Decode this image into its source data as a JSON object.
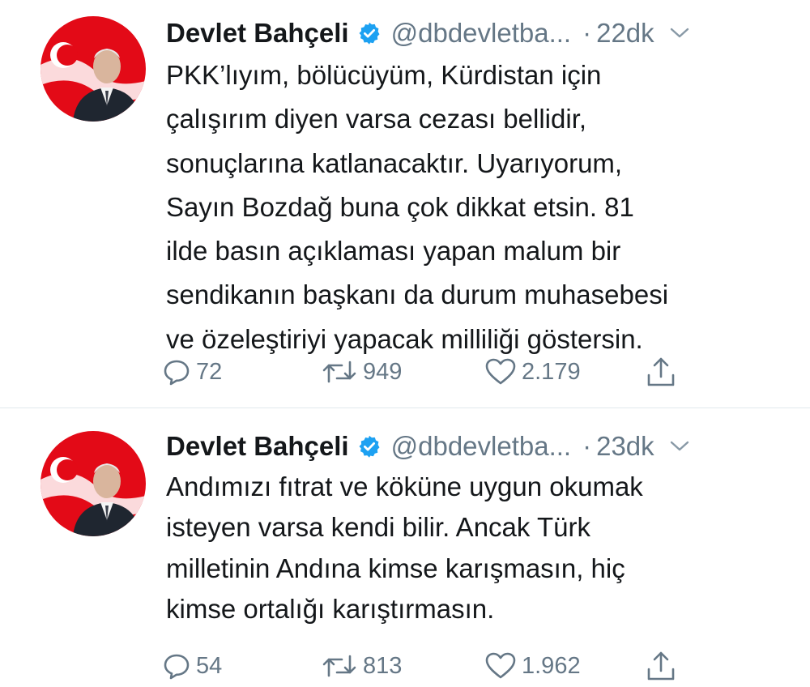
{
  "tweets": [
    {
      "name": "Devlet Bahçeli",
      "handle": "@dbdevletba...",
      "separator": "·",
      "time": "22dk",
      "text": "PKK’lıyım, bölücüyüm, Kürdistan için\nçalışırım diyen varsa cezası bellidir,\nsonuçlarına katlanacaktır. Uyarıyorum,\nSayın Bozdağ buna çok dikkat etsin. 81\nilde basın açıklaması yapan malum bir\nsendikanın başkanı da durum muhasebesi\nve özeleştiriyi yapacak milliliği göstersin.",
      "replies": "72",
      "retweets": "949",
      "likes": "2.179"
    },
    {
      "name": "Devlet Bahçeli",
      "handle": "@dbdevletba...",
      "separator": "·",
      "time": "23dk",
      "text": "Andımızı fıtrat ve köküne uygun okumak\nisteyen varsa kendi bilir. Ancak Türk\nmilletinin Andına kimse karışmasın, hiç\nkimse ortalığı karıştırmasın.",
      "replies": "54",
      "retweets": "813",
      "likes": "1.962"
    }
  ],
  "icons": {
    "verified": "verified-badge-icon",
    "caret": "chevron-down-icon",
    "reply": "reply-icon",
    "retweet": "retweet-icon",
    "like": "heart-icon",
    "share": "share-icon"
  },
  "colors": {
    "verified_blue": "#1da1f2",
    "flag_red": "#e30a17",
    "muted_text": "#657786",
    "text": "#14171a",
    "divider": "#e1e8ed"
  }
}
